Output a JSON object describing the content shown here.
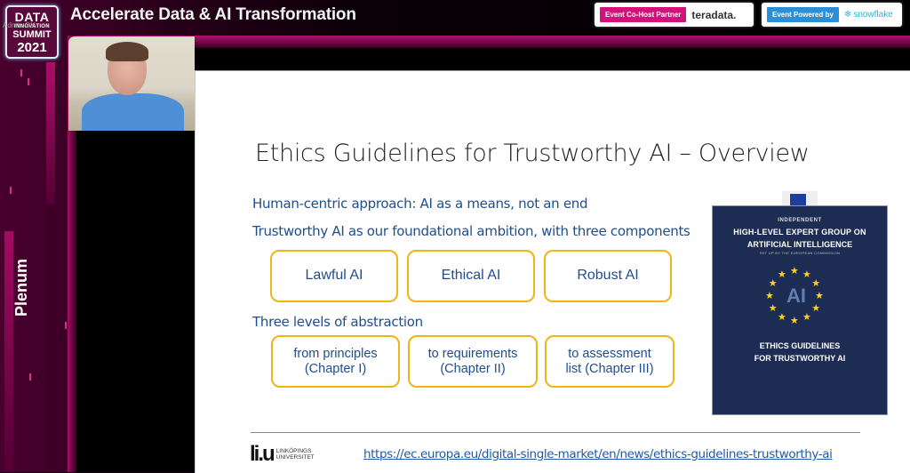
{
  "header": {
    "logo": {
      "line1": "DATA",
      "line2": "INNOVATION",
      "line3": "SUMMIT",
      "line4": "2021",
      "overlay_text": "Admin        OK"
    },
    "event_title": "Accelerate Data & AI Transformation",
    "partners": [
      {
        "tag": "Event Co-Host Partner",
        "brand": "teradata.",
        "tag_color": "#d4117a"
      },
      {
        "tag": "Event Powered by",
        "brand": "snowflake",
        "tag_color": "#2a8fd6",
        "icon": "snowflake-icon"
      }
    ]
  },
  "sidebar": {
    "room_label": "Plenum"
  },
  "webcam": {
    "description": "Presenter in blue shirt"
  },
  "slide": {
    "title": "Ethics Guidelines for Trustworthy AI – Overview",
    "bullets": [
      "Human-centric approach: AI as a means, not an end",
      "Trustworthy AI as our foundational ambition, with three components",
      "Three levels of abstraction"
    ],
    "components": [
      "Lawful AI",
      "Ethical AI",
      "Robust AI"
    ],
    "levels": [
      {
        "line1": "from principles",
        "line2": "(Chapter I)"
      },
      {
        "line1": "to requirements",
        "line2": "(Chapter II)"
      },
      {
        "line1": "to assessment",
        "line2": "list (Chapter III)"
      }
    ],
    "cover": {
      "independent": "INDEPENDENT",
      "group_line1": "HIGH-LEVEL EXPERT GROUP ON",
      "group_line2": "ARTIFICIAL INTELLIGENCE",
      "setup": "SET UP BY THE EUROPEAN COMMISSION",
      "emblem": "AI",
      "title_line1": "ETHICS GUIDELINES",
      "title_line2": "FOR TRUSTWORTHY AI"
    },
    "footer": {
      "university_mark": "li.u",
      "university_line1": "LINKÖPINGS",
      "university_line2": "UNIVERSITET",
      "url": "https://ec.europa.eu/digital-single-market/en/news/ethics-guidelines-trustworthy-ai"
    }
  },
  "colors": {
    "accent_pink": "#c8117a",
    "box_border": "#f0b418",
    "slide_text_blue": "#1f4e8c",
    "cover_navy": "#1d2c52"
  }
}
